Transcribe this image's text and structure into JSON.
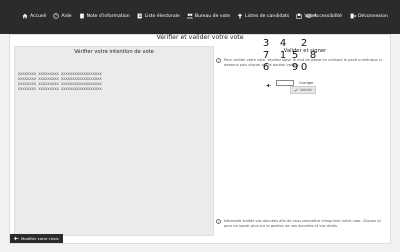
{
  "topbar": {
    "nav": [
      {
        "icon": "home-icon",
        "label": "Accueil"
      },
      {
        "icon": "help-circle-icon",
        "label": "Aide"
      },
      {
        "icon": "document-icon",
        "label": "Note d'information"
      },
      {
        "icon": "list-icon",
        "label": "Liste électorale"
      },
      {
        "icon": "people-icon",
        "label": "Bureau de vote"
      },
      {
        "icon": "list-plus-icon",
        "label": "Listes de candidats"
      },
      {
        "icon": "ballot-icon",
        "label": "Voter"
      }
    ],
    "right": [
      {
        "icon": "accessibility-icon",
        "label": "Accessibilité"
      },
      {
        "icon": "logout-icon",
        "label": "Déconnexion"
      }
    ],
    "colors": {
      "background": "#2b2b2b",
      "text": "#ffffff"
    }
  },
  "main": {
    "title": "Vérifier et valider votre vote",
    "intent": {
      "title": "Vérifier votre intention de vote",
      "lines": [
        "XXXXXXXX XXXXXXXXX XXXXXXXXXXXXXXXXXX",
        "XXXXXXXX XXXXXXXXX XXXXXXXXXXXXXXXXXX",
        "XXXXXXXX XXXXXXXXX XXXXXXXXXXXXXXXXXX",
        "XXXXXXXX XXXXXXXXX XXXXXXXXXXXXXXXXXX"
      ]
    },
    "sign": {
      "title": "Valider et signer",
      "instructions": "Pour valider votre vote, veuillez saisir le mot de passe en utilisant le pavé numérique ci-dessous puis cliquer sur le bouton valider.",
      "keypad": {
        "rows": [
          [
            "3",
            "4",
            "2"
          ],
          [
            "7",
            "1",
            "5",
            "8"
          ],
          [
            "6",
            "",
            "9",
            "0"
          ]
        ]
      },
      "erase_label": "Corriger",
      "validate_label": "Valider",
      "note": "Nécessite traités vos données afin de vous permettre d'exprimer votre vote. Cliquez ici pour en savoir plus sur la gestion de vos données et vos droits."
    },
    "back_label": "Modifier votre choix"
  },
  "colors": {
    "accent": "#2b2b2b",
    "page_bg": "#f2f2f2",
    "panel_bg": "#ebebeb"
  }
}
